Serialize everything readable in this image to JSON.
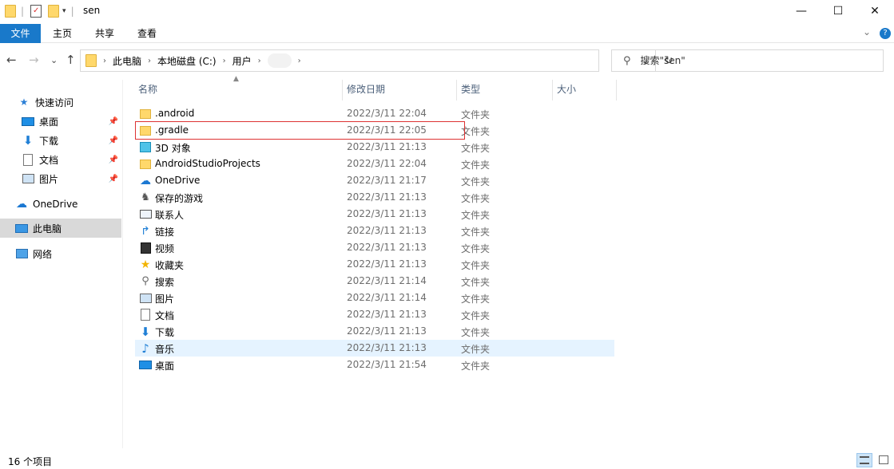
{
  "window": {
    "title": "sen",
    "minimize": "—",
    "maximize": "☐",
    "close": "✕"
  },
  "ribbon": {
    "tabs": [
      "文件",
      "主页",
      "共享",
      "查看"
    ],
    "expand": "⌄",
    "help": "?"
  },
  "nav": {
    "back": "←",
    "forward": "→",
    "recent": "⌄",
    "up": "↑",
    "breadcrumb": [
      "此电脑",
      "本地磁盘 (C:)",
      "用户"
    ],
    "refresh": "↻"
  },
  "search": {
    "placeholder": "搜索\"sen\""
  },
  "sidebar": {
    "items": [
      {
        "label": "快速访问",
        "icon": "star-icon"
      },
      {
        "label": "桌面",
        "icon": "desktop-icon",
        "pinned": true
      },
      {
        "label": "下载",
        "icon": "download-icon",
        "pinned": true
      },
      {
        "label": "文档",
        "icon": "document-icon",
        "pinned": true
      },
      {
        "label": "图片",
        "icon": "picture-icon",
        "pinned": true
      },
      {
        "label": "OneDrive",
        "icon": "cloud-icon"
      },
      {
        "label": "此电脑",
        "icon": "computer-icon",
        "selected": true
      },
      {
        "label": "网络",
        "icon": "network-icon"
      }
    ]
  },
  "columns": [
    "名称",
    "修改日期",
    "类型",
    "大小"
  ],
  "files": [
    {
      "name": ".android",
      "date": "2022/3/11 22:04",
      "type": "文件夹",
      "icon": "folder-icon"
    },
    {
      "name": ".gradle",
      "date": "2022/3/11 22:05",
      "type": "文件夹",
      "icon": "folder-icon"
    },
    {
      "name": "3D 对象",
      "date": "2022/3/11 21:13",
      "type": "文件夹",
      "icon": "3d-objects-icon"
    },
    {
      "name": "AndroidStudioProjects",
      "date": "2022/3/11 22:04",
      "type": "文件夹",
      "icon": "folder-icon"
    },
    {
      "name": "OneDrive",
      "date": "2022/3/11 21:17",
      "type": "文件夹",
      "icon": "cloud-icon"
    },
    {
      "name": "保存的游戏",
      "date": "2022/3/11 21:13",
      "type": "文件夹",
      "icon": "saved-games-icon"
    },
    {
      "name": "联系人",
      "date": "2022/3/11 21:13",
      "type": "文件夹",
      "icon": "contacts-icon"
    },
    {
      "name": "链接",
      "date": "2022/3/11 21:13",
      "type": "文件夹",
      "icon": "links-icon"
    },
    {
      "name": "视频",
      "date": "2022/3/11 21:13",
      "type": "文件夹",
      "icon": "video-icon"
    },
    {
      "name": "收藏夹",
      "date": "2022/3/11 21:13",
      "type": "文件夹",
      "icon": "star-icon"
    },
    {
      "name": "搜索",
      "date": "2022/3/11 21:14",
      "type": "文件夹",
      "icon": "search-icon"
    },
    {
      "name": "图片",
      "date": "2022/3/11 21:14",
      "type": "文件夹",
      "icon": "picture-icon"
    },
    {
      "name": "文档",
      "date": "2022/3/11 21:13",
      "type": "文件夹",
      "icon": "document-icon"
    },
    {
      "name": "下载",
      "date": "2022/3/11 21:13",
      "type": "文件夹",
      "icon": "download-icon"
    },
    {
      "name": "音乐",
      "date": "2022/3/11 21:13",
      "type": "文件夹",
      "icon": "music-icon",
      "hover": true
    },
    {
      "name": "桌面",
      "date": "2022/3/11 21:54",
      "type": "文件夹",
      "icon": "desktop-icon"
    }
  ],
  "status": {
    "count": "16 个项目"
  },
  "colors": {
    "accent": "#1979ca",
    "selection": "#d9d9d9",
    "hover": "#e5f3ff",
    "highlight_box": "#dd3333",
    "folder": "#ffd86b"
  }
}
